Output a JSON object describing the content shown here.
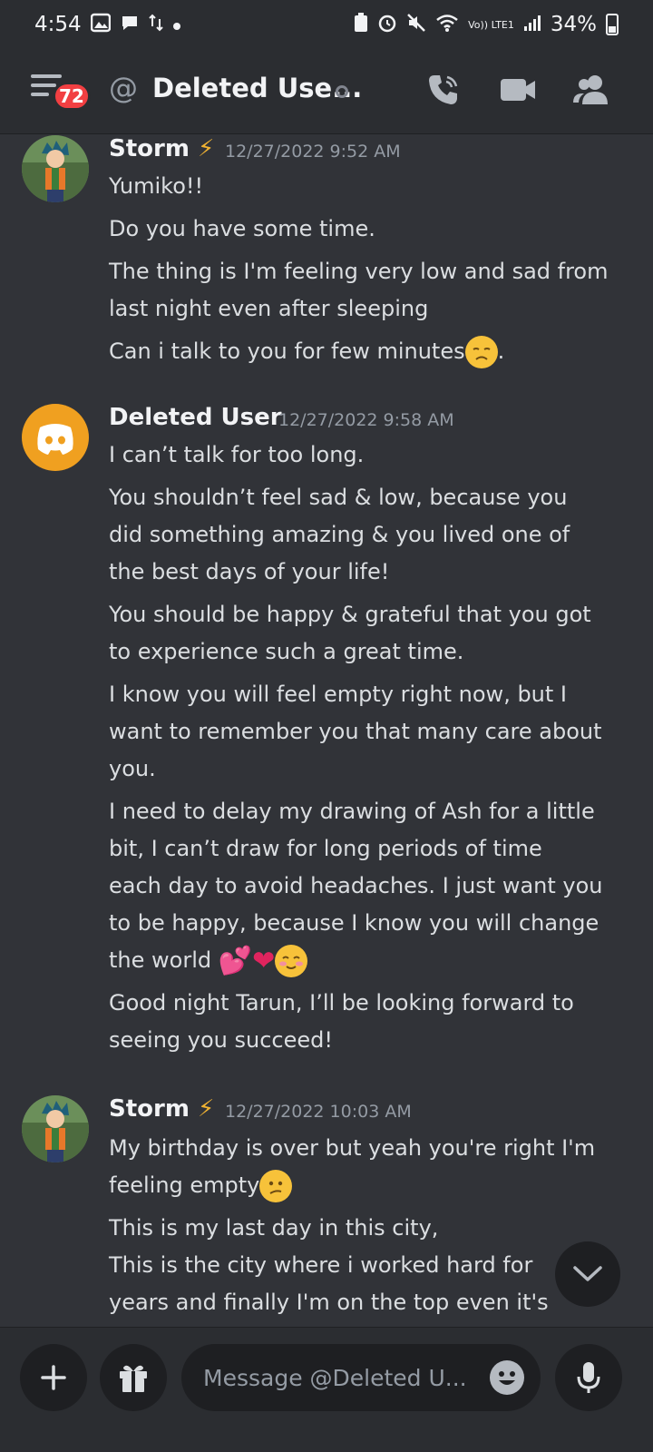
{
  "status_bar": {
    "time": "4:54",
    "network": "Vo)) LTE1",
    "battery": "34%"
  },
  "header": {
    "unread_badge": "72",
    "title": "Deleted Use...",
    "at_symbol": "@"
  },
  "messages": [
    {
      "username": "Storm",
      "timestamp": "12/27/2022 9:52 AM",
      "avatar": "anime-character-avatar",
      "lines": [
        "Yumiko!!",
        "Do you have some time.",
        "The thing is I'm feeling very low and sad from",
        "last night even after sleeping",
        "Can i talk to you for few minutes"
      ]
    },
    {
      "username": "Deleted User",
      "timestamp": "12/27/2022 9:58 AM",
      "avatar": "discord-logo-avatar",
      "lines": [
        "I can’t talk for too long.",
        "You shouldn’t feel sad & low, because you",
        "did something amazing & you lived one of",
        "the best days of your life!",
        "You should be happy & grateful that you got",
        "to experience such a great time.",
        "I know you will feel empty right now, but I",
        "want to remember you that many care about",
        "you.",
        "I need to delay my drawing of Ash for a little",
        "bit, I can’t draw for long periods of time",
        "each day to avoid headaches. I just want you",
        "to be happy, because I know you will change",
        "the world",
        "Good night Tarun, I’ll be looking forward to",
        "seeing you succeed!"
      ]
    },
    {
      "username": "Storm",
      "timestamp": "12/27/2022 10:03 AM",
      "avatar": "anime-character-avatar",
      "lines": [
        "My birthday is over but yeah you're right I'm",
        "feeling empty",
        "This is my last day in this city,",
        "This is the city where i worked hard for",
        "years and finally I'm on the top even it's"
      ]
    }
  ],
  "composer": {
    "placeholder": "Message @Deleted U..."
  },
  "colors": {
    "background": "#313338",
    "header": "#2b2d31",
    "badge": "#f23f42",
    "discord_avatar": "#f0a020",
    "bolt": "#f0b232"
  }
}
